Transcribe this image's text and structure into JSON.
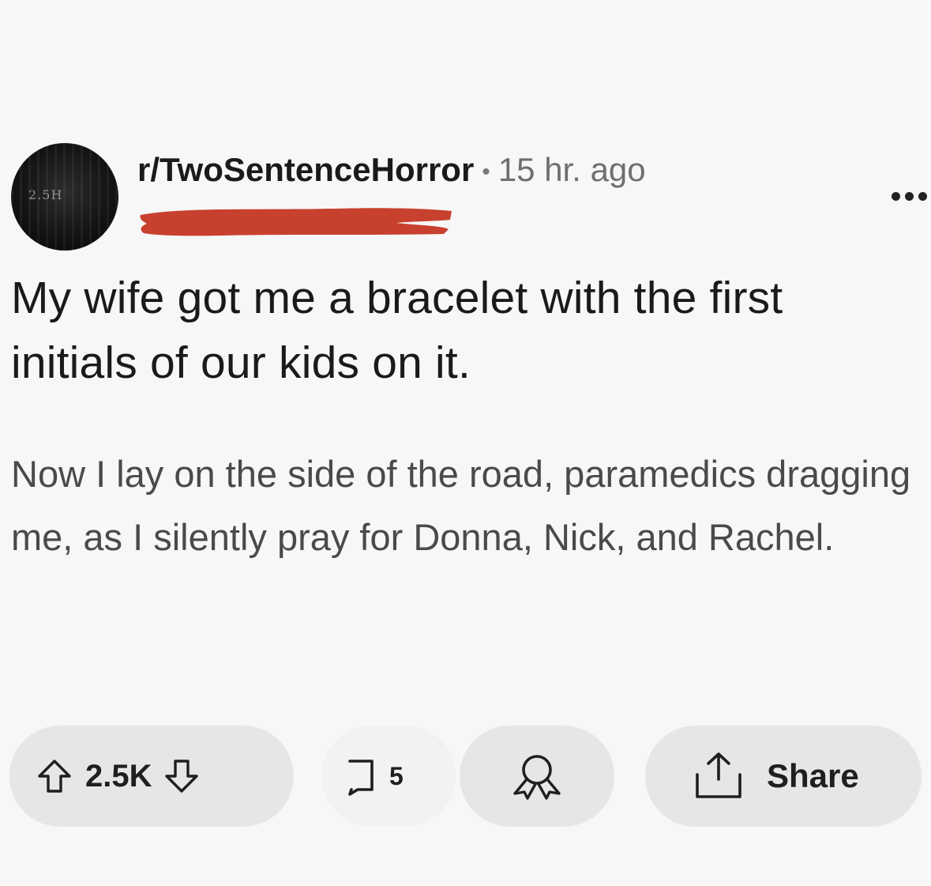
{
  "header": {
    "subreddit": "r/TwoSentenceHorror",
    "separator": "•",
    "time_ago": "15 hr. ago",
    "avatar_text": "2.5H"
  },
  "post": {
    "title": "My wife got me a bracelet with the first initials of our kids on it.",
    "body": "Now I lay on the side of the road, paramedics dragging me, as I silently pray for Donna, Nick, and Rachel."
  },
  "actions": {
    "vote_count": "2.5K",
    "comment_count": "5",
    "share_label": "Share"
  },
  "icons": {
    "upvote": "arrow-up-outline-icon",
    "downvote": "arrow-down-outline-icon",
    "comments": "comment-bubble-icon",
    "award": "award-ribbon-icon",
    "share": "share-upload-icon",
    "more": "more-dots-icon"
  },
  "colors": {
    "background": "#f7f7f7",
    "pill": "#e6e6e6",
    "redaction": "#c8402e",
    "text_primary": "#1a1a1a",
    "text_secondary": "#4a4a4a"
  }
}
